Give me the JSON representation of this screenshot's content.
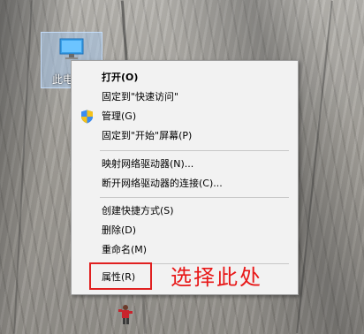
{
  "desktop": {
    "icon_label": "此电",
    "icon_name": "this-pc-icon"
  },
  "context_menu": {
    "items": [
      {
        "label": "打开(O)",
        "bold": true
      },
      {
        "label": "固定到\"快速访问\""
      },
      {
        "label": "管理(G)",
        "icon": "shield-icon"
      },
      {
        "label": "固定到\"开始\"屏幕(P)"
      },
      {
        "label": "映射网络驱动器(N)..."
      },
      {
        "label": "断开网络驱动器的连接(C)..."
      },
      {
        "label": "创建快捷方式(S)"
      },
      {
        "label": "删除(D)"
      },
      {
        "label": "重命名(M)"
      },
      {
        "label": "属性(R)"
      }
    ]
  },
  "annotation": {
    "text": "选择此处",
    "color": "#e81818"
  }
}
